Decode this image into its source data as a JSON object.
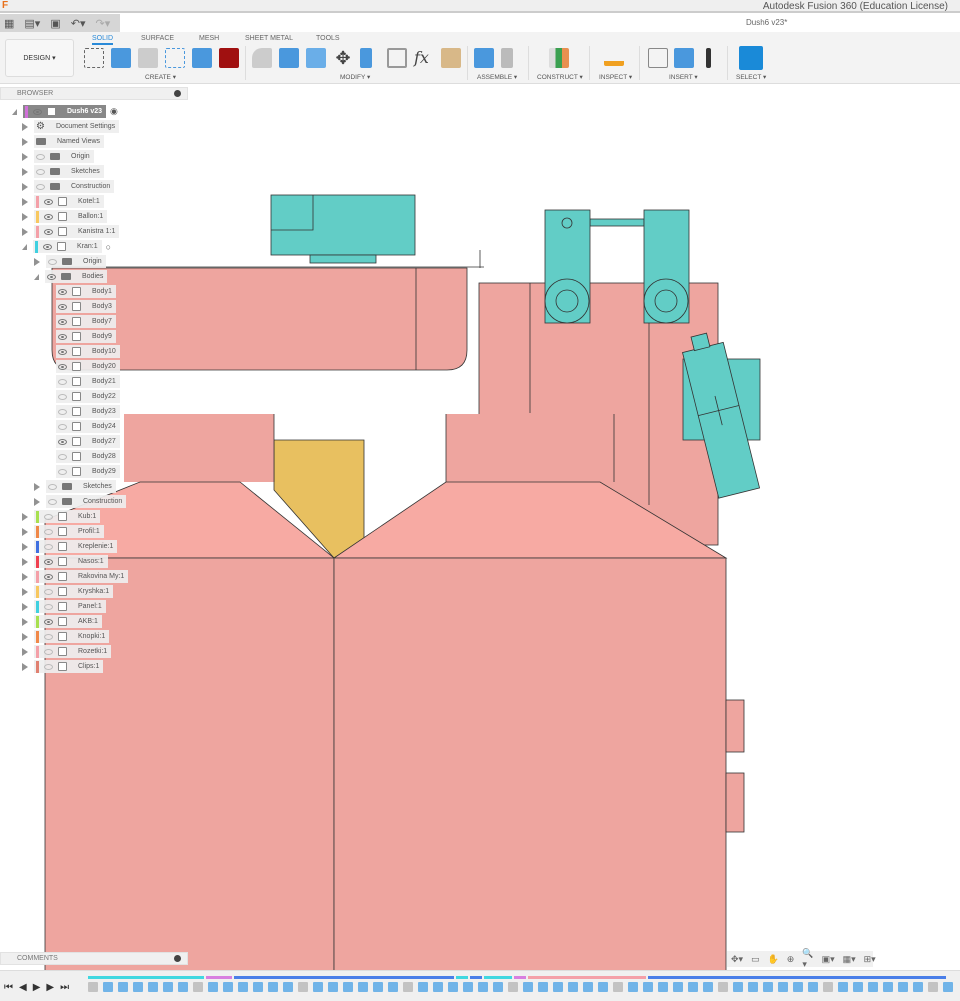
{
  "window": {
    "app_title": "Autodesk Fusion 360 (Education License)",
    "logo": "F",
    "document_title": "Dush6 v23*"
  },
  "quick_access": {
    "icons": [
      "grid-icon",
      "file-icon",
      "save-icon",
      "undo-icon",
      "redo-icon"
    ]
  },
  "ribbon": {
    "workspace": "DESIGN ▾",
    "tabs": [
      {
        "label": "SOLID",
        "active": true
      },
      {
        "label": "SURFACE"
      },
      {
        "label": "MESH"
      },
      {
        "label": "SHEET METAL"
      },
      {
        "label": "TOOLS"
      }
    ],
    "groups": [
      {
        "label": "CREATE ▾"
      },
      {
        "label": "MODIFY ▾"
      },
      {
        "label": "ASSEMBLE ▾"
      },
      {
        "label": "CONSTRUCT ▾"
      },
      {
        "label": "INSPECT ▾"
      },
      {
        "label": "INSERT ▾"
      },
      {
        "label": "SELECT ▾"
      }
    ]
  },
  "browser": {
    "title": "BROWSER",
    "items": [
      {
        "label": "Dush6 v23",
        "level": 0,
        "open": true,
        "color": "#d070d8",
        "type": "root",
        "visible": true
      },
      {
        "label": "Document Settings",
        "level": 1,
        "type": "gear"
      },
      {
        "label": "Named Views",
        "level": 1,
        "type": "folder"
      },
      {
        "label": "Origin",
        "level": 1,
        "type": "folder",
        "visible": false
      },
      {
        "label": "Sketches",
        "level": 1,
        "type": "folder",
        "visible": false
      },
      {
        "label": "Construction",
        "level": 1,
        "type": "folder",
        "visible": false
      },
      {
        "label": "Kotel:1",
        "level": 1,
        "type": "comp",
        "color": "#f4a0a8",
        "visible": true
      },
      {
        "label": "Ballon:1",
        "level": 1,
        "type": "comp",
        "color": "#f8c860",
        "visible": true
      },
      {
        "label": "Kanistra 1:1",
        "level": 1,
        "type": "comp",
        "color": "#f4a0a8",
        "visible": true
      },
      {
        "label": "Kran:1",
        "level": 1,
        "type": "comp",
        "color": "#40d0e0",
        "visible": true,
        "open": true
      },
      {
        "label": "Origin",
        "level": 2,
        "type": "folder",
        "visible": false
      },
      {
        "label": "Bodies",
        "level": 2,
        "type": "folder",
        "visible": true,
        "open": true
      },
      {
        "label": "Body1",
        "level": 3,
        "type": "body",
        "visible": true
      },
      {
        "label": "Body3",
        "level": 3,
        "type": "body",
        "visible": true
      },
      {
        "label": "Body7",
        "level": 3,
        "type": "body",
        "visible": true
      },
      {
        "label": "Body9",
        "level": 3,
        "type": "body",
        "visible": true
      },
      {
        "label": "Body10",
        "level": 3,
        "type": "body",
        "visible": true
      },
      {
        "label": "Body20",
        "level": 3,
        "type": "body",
        "visible": true
      },
      {
        "label": "Body21",
        "level": 3,
        "type": "body",
        "visible": false
      },
      {
        "label": "Body22",
        "level": 3,
        "type": "body",
        "visible": false
      },
      {
        "label": "Body23",
        "level": 3,
        "type": "body",
        "visible": false
      },
      {
        "label": "Body24",
        "level": 3,
        "type": "body",
        "visible": false
      },
      {
        "label": "Body27",
        "level": 3,
        "type": "body",
        "visible": true
      },
      {
        "label": "Body28",
        "level": 3,
        "type": "body",
        "visible": false
      },
      {
        "label": "Body29",
        "level": 3,
        "type": "body",
        "visible": false
      },
      {
        "label": "Sketches",
        "level": 2,
        "type": "folder",
        "visible": false
      },
      {
        "label": "Construction",
        "level": 2,
        "type": "folder",
        "visible": false
      },
      {
        "label": "Kub:1",
        "level": 1,
        "type": "comp",
        "color": "#a8e050",
        "visible": false
      },
      {
        "label": "Profil:1",
        "level": 1,
        "type": "comp",
        "color": "#f08848",
        "visible": false
      },
      {
        "label": "Kreplenie:1",
        "level": 1,
        "type": "comp",
        "color": "#4070e0",
        "visible": false
      },
      {
        "label": "Nasos:1",
        "level": 1,
        "type": "comp",
        "color": "#f04050",
        "visible": true
      },
      {
        "label": "Rakovina My:1",
        "level": 1,
        "type": "comp",
        "color": "#f4a0a8",
        "visible": true
      },
      {
        "label": "Kryshka:1",
        "level": 1,
        "type": "comp",
        "color": "#f8c860",
        "visible": false
      },
      {
        "label": "Panel:1",
        "level": 1,
        "type": "comp",
        "color": "#40d0e0",
        "visible": false
      },
      {
        "label": "AKB:1",
        "level": 1,
        "type": "comp",
        "color": "#a8e050",
        "visible": true
      },
      {
        "label": "Knopki:1",
        "level": 1,
        "type": "comp",
        "color": "#f08848",
        "visible": false
      },
      {
        "label": "Rozetki:1",
        "level": 1,
        "type": "comp",
        "color": "#f4a0a8",
        "visible": false
      },
      {
        "label": "Clips:1",
        "level": 1,
        "type": "comp",
        "color": "#e08070",
        "visible": false
      }
    ]
  },
  "comments": {
    "title": "COMMENTS"
  },
  "nav_bar": {
    "icons": [
      "orbit-icon",
      "look-at-icon",
      "pan-icon",
      "zoom-window-icon",
      "zoom-icon",
      "display-settings-icon",
      "grid-icon",
      "viewports-icon"
    ]
  },
  "timeline": {
    "controls": [
      "⏮",
      "◀",
      "▶",
      "▶",
      "⏭"
    ],
    "segment_colors": [
      "#40d8e0",
      "#d880e0",
      "#4a7ee8",
      "#40d8e0",
      "#4a7ee8",
      "#40d8e0",
      "#d880e0",
      "#f4a0a8",
      "#4a7ee8"
    ]
  },
  "colors": {
    "body_pink": "#eea59f",
    "body_light": "#f7aaa3",
    "teal": "#62cdc6",
    "yellow": "#e8c060",
    "accent": "#2a8ad8"
  }
}
